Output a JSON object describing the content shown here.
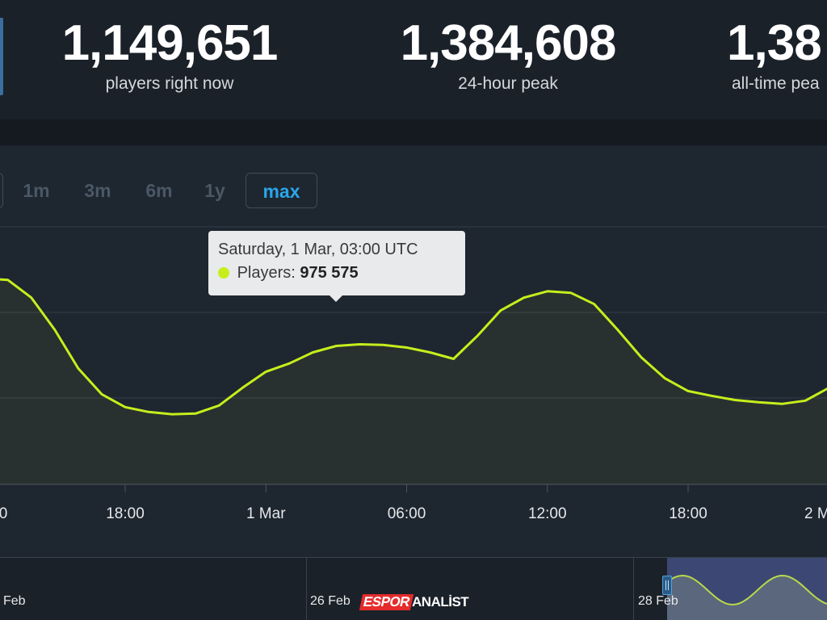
{
  "stats": [
    {
      "value": "1,149,651",
      "label": "players right now"
    },
    {
      "value": "1,384,608",
      "label": "24-hour peak"
    },
    {
      "value": "1,38",
      "label": "all-time pea"
    }
  ],
  "range_buttons": [
    {
      "label": "1m",
      "active": false
    },
    {
      "label": "3m",
      "active": false
    },
    {
      "label": "6m",
      "active": false
    },
    {
      "label": "1y",
      "active": false
    },
    {
      "label": "max",
      "active": true
    }
  ],
  "tooltip": {
    "title": "Saturday, 1 Mar, 03:00 UTC",
    "series_label": "Players:",
    "value": "975 575"
  },
  "chart_data": {
    "type": "area",
    "series": [
      {
        "x_hours": [
          10,
          11,
          12,
          13,
          14,
          15,
          16,
          17,
          18,
          19,
          20,
          21,
          22,
          23,
          24,
          25,
          26,
          27,
          28,
          29,
          30,
          31,
          32,
          33,
          34,
          35,
          36,
          37,
          38,
          39,
          40,
          41,
          42,
          43,
          44,
          45,
          46,
          47,
          48
        ],
        "values": [
          1180000,
          1230000,
          1240000,
          1235000,
          1180000,
          1080000,
          960000,
          880000,
          840000,
          825000,
          818000,
          820000,
          845000,
          900000,
          950000,
          975575,
          1010000,
          1030000,
          1035000,
          1033000,
          1025000,
          1010000,
          990000,
          1060000,
          1140000,
          1180000,
          1200000,
          1195000,
          1160000,
          1080000,
          995000,
          930000,
          890000,
          875000,
          862000,
          855000,
          850000,
          860000,
          900000
        ]
      }
    ],
    "x_ticks": [
      "0",
      "18:00",
      "1 Mar",
      "06:00",
      "12:00",
      "18:00",
      "2 M"
    ],
    "y_range": [
      600000,
      1400000
    ],
    "grid": true,
    "line_color": "#c6ee1c"
  },
  "navigator": {
    "labels": [
      "Feb",
      "26 Feb",
      "28 Feb"
    ]
  },
  "watermark": {
    "part_a": "ESPOR",
    "part_b": "ANALİST"
  }
}
